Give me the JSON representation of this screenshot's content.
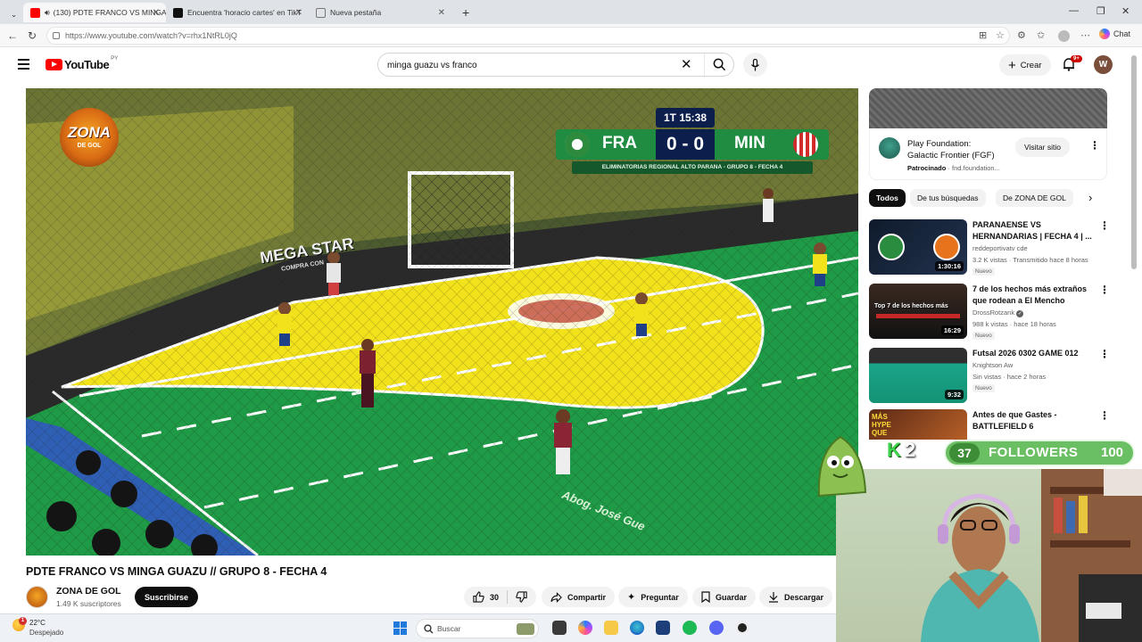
{
  "browser": {
    "tabs": [
      {
        "label": "(130) PDTE FRANCO VS MINGA G",
        "icon_color": "#ff0000",
        "active": true
      },
      {
        "label": "Encuentra 'horacio cartes' en TikT",
        "icon_color": "#111111",
        "active": false
      },
      {
        "label": "Nueva pestaña",
        "icon_color": "#777777",
        "active": false
      }
    ],
    "url": "https://www.youtube.com/watch?v=rhx1NtRL0jQ",
    "chat_label": "Chat"
  },
  "youtube": {
    "logo_text": "YouTube",
    "region": "PY",
    "search_value": "minga guazu vs franco",
    "create_label": "Crear",
    "notifications_count": "9+",
    "user_initial": "W",
    "accent": "#ff0000"
  },
  "player": {
    "overlay_logo": {
      "line1": "ZONA",
      "line2": "DE GOL"
    },
    "scoreboard": {
      "clock": "1T 15:38",
      "home": "FRA",
      "away": "MIN",
      "score": "0 - 0",
      "subtitle": "ELIMINATORIAS REGIONAL ALTO PARANA - GRUPO 8 - FECHA 4"
    },
    "sponsor_board": "MEGA STAR",
    "sponsor_sub": "COMPRA CON",
    "court_text": "Abog. José Gue"
  },
  "video": {
    "title": "PDTE FRANCO VS MINGA GUAZU // GRUPO 8 - FECHA 4",
    "channel": "ZONA DE GOL",
    "subscribers": "1.49 K suscriptores",
    "subscribe_label": "Suscribirse",
    "likes": "30",
    "share_label": "Compartir",
    "ask_label": "Preguntar",
    "save_label": "Guardar",
    "download_label": "Descargar"
  },
  "ad": {
    "title": "Play Foundation: Galactic Frontier (FGF)",
    "sponsored_label": "Patrocinado",
    "domain": "fnd.foundation...",
    "visit_label": "Visitar sitio"
  },
  "chips": [
    "Todos",
    "De tus búsquedas",
    "De ZONA DE GOL"
  ],
  "recommendations": [
    {
      "title": "PARANAENSE VS HERNANDARIAS | FECHA 4 | ...",
      "channel": "reddeportivatv cde",
      "meta": "3.2 K vistas · Transmitido hace 8 horas",
      "badge": "Nuevo",
      "duration": "1:30:16"
    },
    {
      "title": "7 de los hechos más extraños que rodean a El Mencho",
      "channel": "DrossRotzank",
      "meta": "988 k vistas · hace 18 horas",
      "badge": "Nuevo",
      "duration": "16:29",
      "thumb_text": "Top 7 de los hechos más"
    },
    {
      "title": "Futsal 2026 0302 GAME 012",
      "channel": "Knightson Aw",
      "meta": "Sin vistas · hace 2 horas",
      "badge": "Nuevo",
      "duration": "9:32"
    },
    {
      "title": "Antes de que Gastes - BATTLEFIELD 6",
      "channel": "",
      "meta": "",
      "badge": "",
      "duration": "",
      "thumb_text": "MÁS HYPE QUE"
    }
  ],
  "stream_overlay": {
    "followers_current": "37",
    "followers_label": "FOLLOWERS",
    "followers_goal": "100",
    "followers_progress": 0.37,
    "kick_letter": "K",
    "kick_count": "2"
  },
  "taskbar": {
    "temperature": "22°C",
    "condition": "Despejado",
    "weather_alert": "1",
    "search_placeholder": "Buscar"
  }
}
